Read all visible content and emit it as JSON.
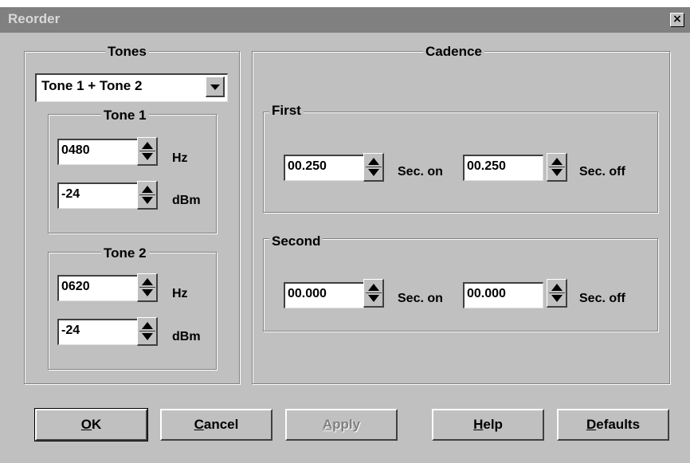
{
  "window": {
    "title": "Reorder",
    "close_glyph": "×"
  },
  "tones": {
    "label": "Tones",
    "combo_value": "Tone 1 + Tone 2",
    "tone1": {
      "label": "Tone 1",
      "freq": "0480",
      "freq_unit": "Hz",
      "level": "-24",
      "level_unit": "dBm"
    },
    "tone2": {
      "label": "Tone 2",
      "freq": "0620",
      "freq_unit": "Hz",
      "level": "-24",
      "level_unit": "dBm"
    }
  },
  "cadence": {
    "label": "Cadence",
    "first": {
      "label": "First",
      "on_value": "00.250",
      "on_unit": "Sec. on",
      "off_value": "00.250",
      "off_unit": "Sec. off"
    },
    "second": {
      "label": "Second",
      "on_value": "00.000",
      "on_unit": "Sec. on",
      "off_value": "00.000",
      "off_unit": "Sec. off"
    }
  },
  "buttons": {
    "ok": {
      "mnemonic": "O",
      "rest": "K"
    },
    "cancel": {
      "mnemonic": "C",
      "rest": "ancel"
    },
    "apply": {
      "mnemonic": "A",
      "rest": "pply"
    },
    "help": {
      "mnemonic": "H",
      "rest": "elp"
    },
    "defaults": {
      "mnemonic": "D",
      "rest": "efaults"
    }
  },
  "icons": {
    "spin": "spin-up-down-icon",
    "dropdown": "dropdown-arrow-icon",
    "close": "close-icon"
  },
  "colors": {
    "title_bar": "#808080",
    "dialog_bg": "#c0c0c0",
    "field_bg": "#ffffff"
  }
}
